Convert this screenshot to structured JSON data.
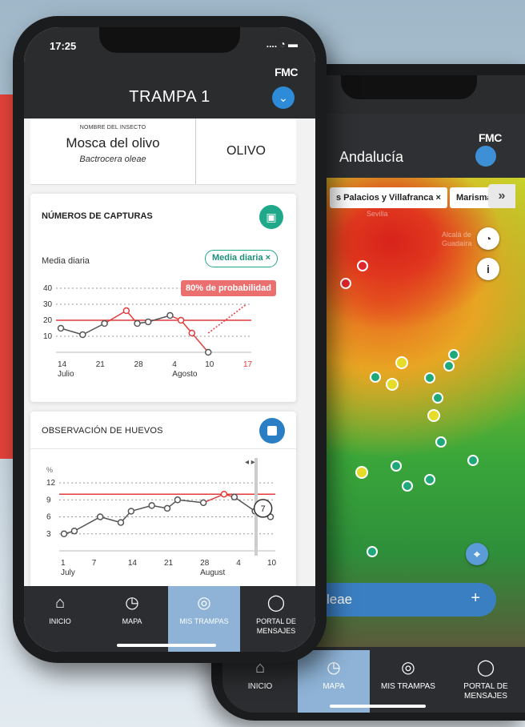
{
  "phone_front": {
    "status": {
      "time": "17:25"
    },
    "brand": "FMC",
    "title": "TRAMPA 1",
    "insect": {
      "label": "NOMBRE DEL INSECTO",
      "name": "Mosca del olivo",
      "scientific": "Bactrocera oleae",
      "crop": "OLIVO"
    },
    "captures": {
      "title": "NÚMEROS DE CAPTURAS",
      "subtitle": "Media diaria",
      "filter_chip": "Media diaria ×",
      "probability": "80% de probabilidad"
    },
    "eggs": {
      "title": "OBSERVACIÓN DE HUEVOS",
      "tooltip_value": "7"
    },
    "nav": [
      {
        "label": "INICIO",
        "icon": "home-icon"
      },
      {
        "label": "MAPA",
        "icon": "map-icon"
      },
      {
        "label": "MIS TRAMPAS",
        "icon": "target-icon",
        "active": true
      },
      {
        "label": "PORTAL DE MENSAJES",
        "icon": "chat-icon"
      }
    ]
  },
  "phone_back": {
    "brand": "FMC",
    "region": "Andalucía",
    "chips": [
      "s Palacios y Villafranca  ×",
      "Marisma"
    ],
    "chips_more": "»",
    "map_buttons": {
      "clock": "◔",
      "info": "i"
    },
    "map_labels": [
      "Sevilla",
      "Alcalá de Guadaíra"
    ],
    "bar_text": "leae",
    "bar_plus": "+",
    "nav": [
      {
        "label": "INICIO",
        "icon": "home-icon"
      },
      {
        "label": "MAPA",
        "icon": "map-icon",
        "active": true
      },
      {
        "label": "MIS TRAMPAS",
        "icon": "target-icon"
      },
      {
        "label": "PORTAL DE MENSAJES",
        "icon": "chat-icon"
      }
    ]
  },
  "chart_data": [
    {
      "type": "line",
      "title": "NÚMEROS DE CAPTURAS",
      "xlabel": "",
      "ylabel": "",
      "y_ticks": [
        10,
        20,
        30,
        40
      ],
      "ylim": [
        0,
        40
      ],
      "x_ticks": [
        "14",
        "21",
        "28",
        "4",
        "10",
        "17"
      ],
      "x_tick_values": [
        14,
        21,
        28,
        35,
        41,
        48
      ],
      "x_month_labels": [
        "Julio",
        "Agosto"
      ],
      "threshold": 20,
      "x": [
        14,
        18,
        22,
        26,
        28,
        30,
        34,
        36,
        38,
        41
      ],
      "series": [
        {
          "values": [
            15,
            11,
            18,
            26,
            18,
            19,
            23,
            20,
            12,
            0
          ]
        }
      ],
      "highlight_x": [
        26,
        36,
        38
      ],
      "forecast": {
        "from_x": 41,
        "from_y": 12,
        "to_x": 48,
        "to_y": 30
      },
      "colors": {
        "line": "#555555",
        "threshold": "#e23b3b",
        "highlight": "#e23b3b",
        "forecast": "#e23b3b"
      }
    },
    {
      "type": "line",
      "title": "OBSERVACIÓN DE HUEVOS",
      "ylabel": "%",
      "y_ticks": [
        3,
        6,
        9,
        12
      ],
      "ylim": [
        0,
        13
      ],
      "x_ticks": [
        "1",
        "7",
        "14",
        "21",
        "28",
        "4",
        "10"
      ],
      "x_tick_values": [
        1,
        7,
        14,
        21,
        28,
        35,
        41
      ],
      "x_month_labels": [
        "July",
        "August"
      ],
      "threshold": 10,
      "x": [
        1,
        3,
        8,
        12,
        14,
        18,
        21,
        23,
        28,
        32,
        34,
        38,
        41
      ],
      "series": [
        {
          "values": [
            3,
            3.5,
            6,
            5,
            7,
            8,
            7.5,
            9,
            8.5,
            10,
            9.5,
            7,
            6
          ]
        }
      ],
      "highlight_x": [
        32
      ],
      "colors": {
        "line": "#555555",
        "threshold": "#e23b3b",
        "highlight": "#e23b3b"
      }
    }
  ]
}
